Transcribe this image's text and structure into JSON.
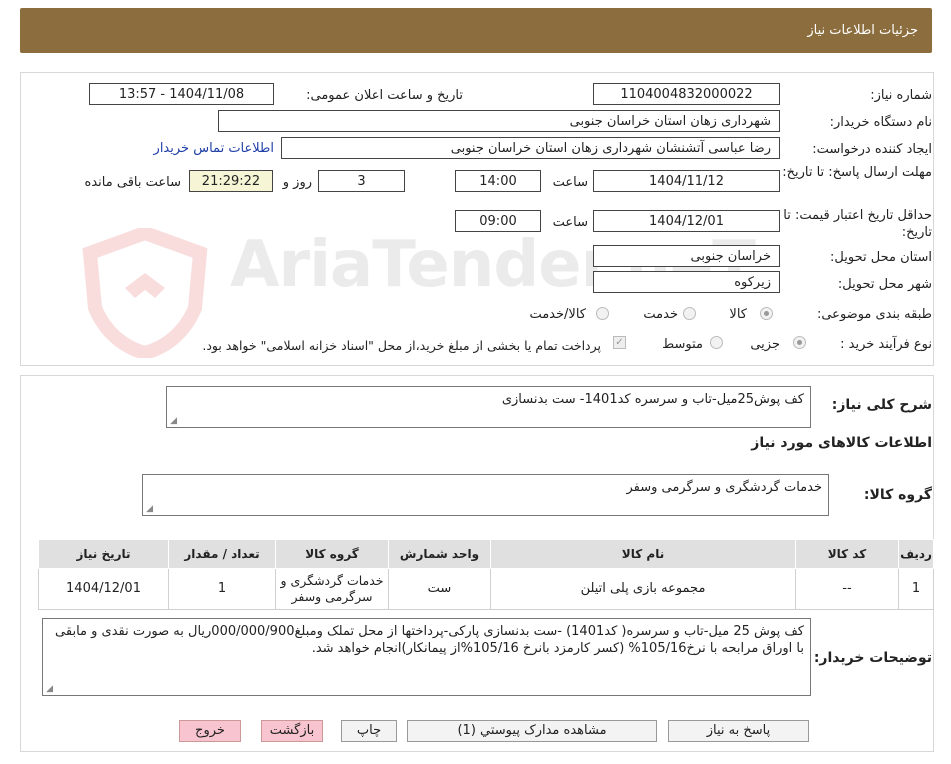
{
  "header": {
    "title": "جزئیات اطلاعات نیاز"
  },
  "fields": {
    "need_number_label": "شماره نیاز:",
    "need_number": "1104004832000022",
    "announce_label": "تاریخ و ساعت اعلان عمومی:",
    "announce_value": "1404/11/08 - 13:57",
    "buyer_label": "نام دستگاه خریدار:",
    "buyer_value": "شهرداری زهان استان خراسان جنوبی",
    "creator_label": "ایجاد کننده درخواست:",
    "creator_value": "رضا عباسی آتشنشان شهرداری زهان استان خراسان جنوبی",
    "contact_link": "اطلاعات تماس خریدار",
    "deadline_label": "مهلت ارسال پاسخ: تا تاریخ:",
    "deadline_date": "1404/11/12",
    "time_label": "ساعت",
    "deadline_time": "14:00",
    "days_value": "3",
    "days_label": "روز و",
    "remaining_time": "21:29:22",
    "remaining_label": "ساعت باقی مانده",
    "validity_label": "حداقل تاریخ اعتبار قیمت: تا تاریخ:",
    "validity_date": "1404/12/01",
    "validity_time": "09:00",
    "province_label": "استان محل تحویل:",
    "province_value": "خراسان جنوبی",
    "city_label": "شهر محل تحویل:",
    "city_value": "زیرکوه",
    "category_label": "طبقه بندی موضوعی:",
    "category_options": [
      "کالا",
      "خدمت",
      "کالا/خدمت"
    ],
    "process_label": "نوع فرآیند خرید :",
    "process_options": [
      "جزیی",
      "متوسط"
    ],
    "payment_note": "پرداخت تمام یا بخشی از مبلغ خرید،از محل \"اسناد خزانه اسلامی\" خواهد بود."
  },
  "summary": {
    "label": "شرح کلی نیاز:",
    "value": "کف پوش25میل-تاب و سرسره کد1401- ست بدنسازی",
    "goods_title": "اطلاعات کالاهای مورد نیاز",
    "group_label": "گروه کالا:",
    "group_value": "خدمات گردشگری و سرگرمی وسفر"
  },
  "table": {
    "headers": [
      "ردیف",
      "کد کالا",
      "نام کالا",
      "واحد شمارش",
      "گروه کالا",
      "تعداد / مقدار",
      "تاریخ نیاز"
    ],
    "row": [
      "1",
      "--",
      "مجموعه بازی پلی اتیلن",
      "ست",
      "خدمات گردشگری و سرگرمی وسفر",
      "1",
      "1404/12/01"
    ]
  },
  "notes": {
    "label": "توضیحات خریدار:",
    "value": "کف پوش 25 میل-تاب و سرسره( کد1401) -ست بدنسازی پارکی-پرداختها از محل تملک ومبلغ000/000/900ریال به صورت نقدی و مابقی با اوراق مرابحه با نرخ105/16% (کسر کارمزد بانرخ 105/16%از پیمانکار)انجام خواهد شد."
  },
  "buttons": {
    "reply": "پاسخ به نیاز",
    "docs": "مشاهده مدارک پیوستي (1)",
    "print": "چاپ",
    "back": "بازگشت",
    "exit": "خروج"
  },
  "watermark": {
    "text": "AriaTender.neT"
  }
}
